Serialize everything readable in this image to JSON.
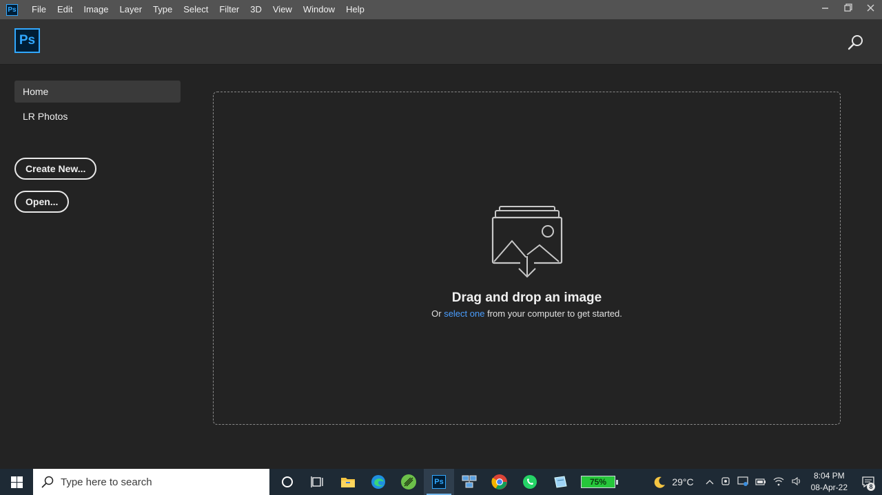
{
  "menubar": {
    "app_icon": "Ps",
    "menus": [
      "File",
      "Edit",
      "Image",
      "Layer",
      "Type",
      "Select",
      "Filter",
      "3D",
      "View",
      "Window",
      "Help"
    ],
    "window_controls": [
      "minimize-icon",
      "restore-icon",
      "close-icon"
    ]
  },
  "header": {
    "logo": "Ps",
    "search_icon": "search-icon"
  },
  "nav": {
    "items": [
      {
        "label": "Home",
        "active": true
      },
      {
        "label": "LR Photos",
        "active": false
      }
    ],
    "create_new": "Create New...",
    "open": "Open..."
  },
  "dropzone": {
    "title": "Drag and drop an image",
    "sub_prefix": "Or",
    "sub_link": "select one",
    "sub_suffix": "from your computer to get started.",
    "icon": "image-upload-icon"
  },
  "taskbar": {
    "search_placeholder": "Type here to search",
    "apps": [
      "cortana-icon",
      "task-view-icon",
      "file-explorer-icon",
      "edge-icon",
      "green-app-icon",
      "photoshop-icon",
      "network-app-icon",
      "chrome-icon",
      "whatsapp-icon",
      "notes-icon"
    ],
    "battery": "75%",
    "weather_temp": "29°C",
    "time": "8:04 PM",
    "date": "08-Apr-22",
    "notification_count": "8"
  },
  "colors": {
    "accent_blue": "#31a8ff",
    "link_blue": "#4a9eff",
    "background": "#232323",
    "header": "#323232",
    "menubar": "#535353"
  }
}
